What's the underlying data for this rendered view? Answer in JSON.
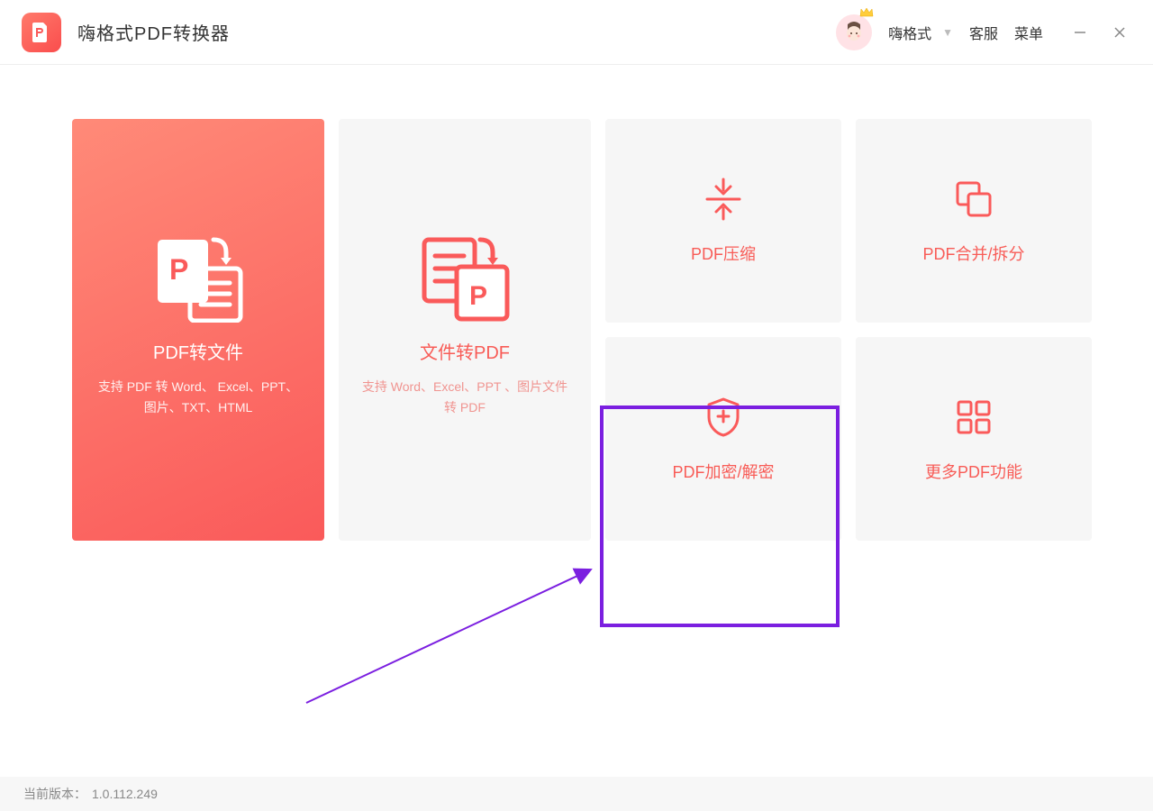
{
  "titlebar": {
    "app_title": "嗨格式PDF转换器",
    "user_name": "嗨格式",
    "support_label": "客服",
    "menu_label": "菜单"
  },
  "cards": {
    "pdf_to_file": {
      "title": "PDF转文件",
      "subtitle": "支持 PDF 转 Word、 Excel、PPT、图片、TXT、HTML"
    },
    "file_to_pdf": {
      "title": "文件转PDF",
      "subtitle": "支持 Word、Excel、PPT 、图片文件转 PDF"
    },
    "compress": {
      "title": "PDF压缩"
    },
    "merge_split": {
      "title": "PDF合并/拆分"
    },
    "encrypt": {
      "title": "PDF加密/解密"
    },
    "more": {
      "title": "更多PDF功能"
    }
  },
  "footer": {
    "label": "当前版本：",
    "version": "1.0.112.249"
  },
  "colors": {
    "accent": "#fa5a5a",
    "highlight": "#7b1fe0"
  }
}
